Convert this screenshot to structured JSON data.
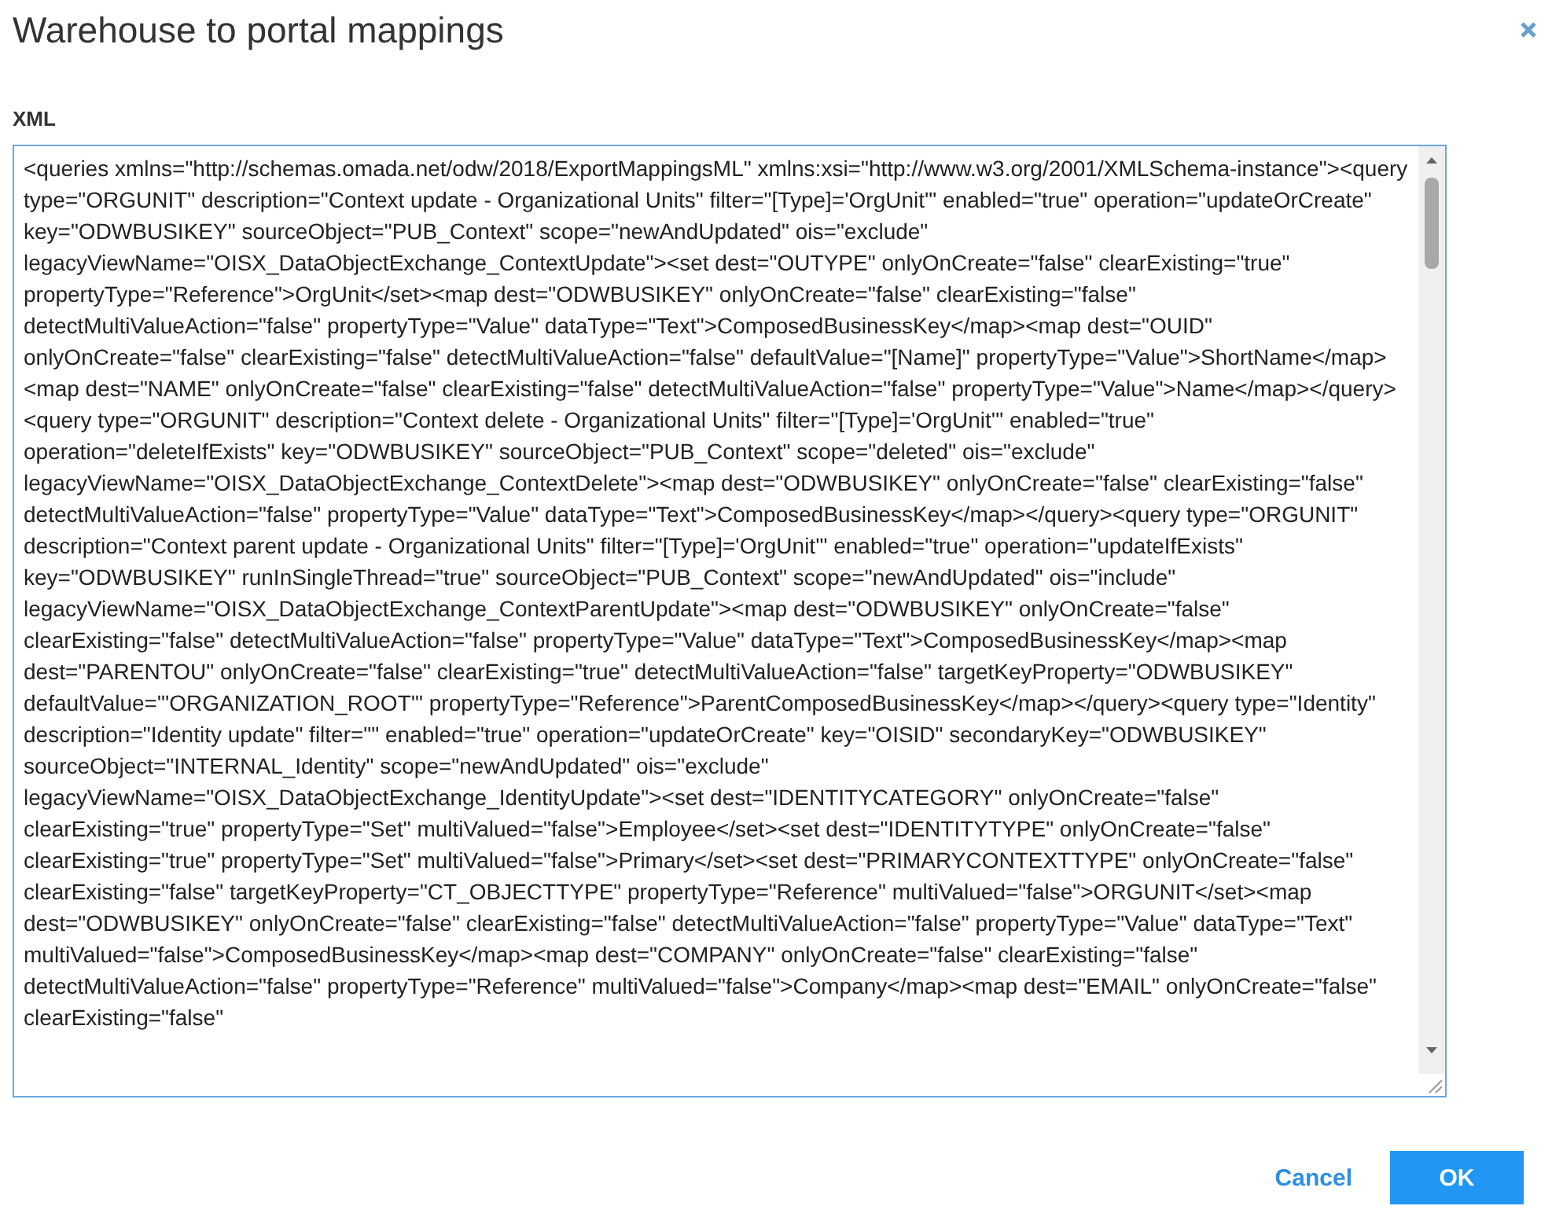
{
  "dialog": {
    "title": "Warehouse to portal mappings"
  },
  "xml_field": {
    "label": "XML",
    "focused": true,
    "value": "<queries xmlns=\"http://schemas.omada.net/odw/2018/ExportMappingsML\" xmlns:xsi=\"http://www.w3.org/2001/XMLSchema-instance\"><query type=\"ORGUNIT\" description=\"Context update - Organizational Units\" filter=\"[Type]='OrgUnit'\" enabled=\"true\" operation=\"updateOrCreate\" key=\"ODWBUSIKEY\" sourceObject=\"PUB_Context\" scope=\"newAndUpdated\" ois=\"exclude\" legacyViewName=\"OISX_DataObjectExchange_ContextUpdate\"><set dest=\"OUTYPE\" onlyOnCreate=\"false\" clearExisting=\"true\" propertyType=\"Reference\">OrgUnit</set><map dest=\"ODWBUSIKEY\" onlyOnCreate=\"false\" clearExisting=\"false\" detectMultiValueAction=\"false\" propertyType=\"Value\" dataType=\"Text\">ComposedBusinessKey</map><map dest=\"OUID\" onlyOnCreate=\"false\" clearExisting=\"false\" detectMultiValueAction=\"false\" defaultValue=\"[Name]\" propertyType=\"Value\">ShortName</map><map dest=\"NAME\" onlyOnCreate=\"false\" clearExisting=\"false\" detectMultiValueAction=\"false\" propertyType=\"Value\">Name</map></query><query type=\"ORGUNIT\" description=\"Context delete - Organizational Units\" filter=\"[Type]='OrgUnit'\" enabled=\"true\" operation=\"deleteIfExists\" key=\"ODWBUSIKEY\" sourceObject=\"PUB_Context\" scope=\"deleted\" ois=\"exclude\" legacyViewName=\"OISX_DataObjectExchange_ContextDelete\"><map dest=\"ODWBUSIKEY\" onlyOnCreate=\"false\" clearExisting=\"false\" detectMultiValueAction=\"false\" propertyType=\"Value\" dataType=\"Text\">ComposedBusinessKey</map></query><query type=\"ORGUNIT\" description=\"Context parent update - Organizational Units\" filter=\"[Type]='OrgUnit'\" enabled=\"true\" operation=\"updateIfExists\" key=\"ODWBUSIKEY\" runInSingleThread=\"true\" sourceObject=\"PUB_Context\" scope=\"newAndUpdated\" ois=\"include\" legacyViewName=\"OISX_DataObjectExchange_ContextParentUpdate\"><map dest=\"ODWBUSIKEY\" onlyOnCreate=\"false\" clearExisting=\"false\" detectMultiValueAction=\"false\" propertyType=\"Value\" dataType=\"Text\">ComposedBusinessKey</map><map dest=\"PARENTOU\" onlyOnCreate=\"false\" clearExisting=\"true\" detectMultiValueAction=\"false\" targetKeyProperty=\"ODWBUSIKEY\" defaultValue=\"'ORGANIZATION_ROOT'\" propertyType=\"Reference\">ParentComposedBusinessKey</map></query><query type=\"Identity\" description=\"Identity update\" filter=\"\" enabled=\"true\" operation=\"updateOrCreate\" key=\"OISID\" secondaryKey=\"ODWBUSIKEY\" sourceObject=\"INTERNAL_Identity\" scope=\"newAndUpdated\" ois=\"exclude\" legacyViewName=\"OISX_DataObjectExchange_IdentityUpdate\"><set dest=\"IDENTITYCATEGORY\" onlyOnCreate=\"false\" clearExisting=\"true\" propertyType=\"Set\" multiValued=\"false\">Employee</set><set dest=\"IDENTITYTYPE\" onlyOnCreate=\"false\" clearExisting=\"true\" propertyType=\"Set\" multiValued=\"false\">Primary</set><set dest=\"PRIMARYCONTEXTTYPE\" onlyOnCreate=\"false\" clearExisting=\"false\" targetKeyProperty=\"CT_OBJECTTYPE\" propertyType=\"Reference\" multiValued=\"false\">ORGUNIT</set><map dest=\"ODWBUSIKEY\" onlyOnCreate=\"false\" clearExisting=\"false\" detectMultiValueAction=\"false\" propertyType=\"Value\" dataType=\"Text\" multiValued=\"false\">ComposedBusinessKey</map><map dest=\"COMPANY\" onlyOnCreate=\"false\" clearExisting=\"false\" detectMultiValueAction=\"false\" propertyType=\"Reference\" multiValued=\"false\">Company</map><map dest=\"EMAIL\" onlyOnCreate=\"false\" clearExisting=\"false\""
  },
  "buttons": [
    {
      "label": "Cancel",
      "kind": "link"
    },
    {
      "label": "OK",
      "kind": "primary"
    }
  ]
}
